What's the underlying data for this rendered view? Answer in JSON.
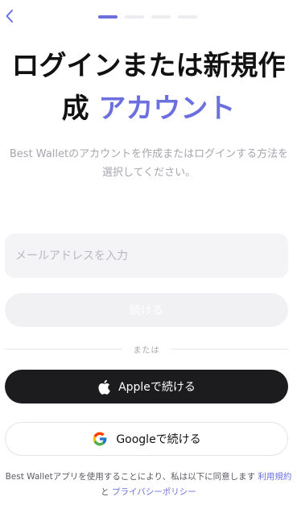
{
  "header": {
    "back_icon": "chevron-left-icon",
    "progress": {
      "total_steps": 4,
      "current_step": 1
    }
  },
  "title": {
    "line1": "ログインまたは新規作",
    "line2_prefix": "成",
    "line2_accent": "アカウント"
  },
  "subtitle": "Best Walletのアカウントを作成またはログインする方法を選択してください。",
  "email": {
    "placeholder": "メールアドレスを入力",
    "value": ""
  },
  "continue_label": "続ける",
  "divider_label": "または",
  "apple": {
    "label": "Appleで続ける",
    "icon": "apple-icon"
  },
  "google": {
    "label": "Googleで続ける",
    "icon": "google-icon"
  },
  "terms": {
    "prefix": "Best Walletアプリを使用することにより、私は以下に同意します",
    "terms_link": "利用規約",
    "conjunction": "と",
    "privacy_link": "プライバシーポリシー"
  },
  "colors": {
    "accent": "#6b70de",
    "dark_button": "#1c1c1e",
    "disabled_button": "#f1f1f4",
    "input_bg": "#f4f4f6",
    "muted_text": "#a6a6ae"
  }
}
